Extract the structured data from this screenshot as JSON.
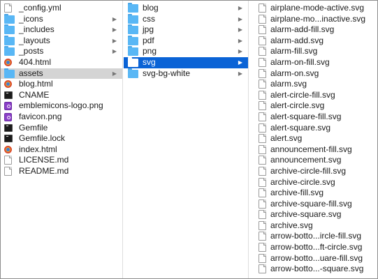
{
  "colors": {
    "folder": "#59b7f5",
    "folder_tab": "#4aa6e6",
    "folder_on_blue": "#ffffff",
    "selection_active": "#0a63d6",
    "selection_inactive": "#d4d4d4"
  },
  "column1": {
    "items": [
      {
        "label": "_config.yml",
        "icon": "document-icon",
        "chevron": false
      },
      {
        "label": "_icons",
        "icon": "folder-icon",
        "chevron": true
      },
      {
        "label": "_includes",
        "icon": "folder-icon",
        "chevron": true
      },
      {
        "label": "_layouts",
        "icon": "folder-icon",
        "chevron": true
      },
      {
        "label": "_posts",
        "icon": "folder-icon",
        "chevron": true
      },
      {
        "label": "404.html",
        "icon": "html-icon",
        "chevron": false
      },
      {
        "label": "assets",
        "icon": "folder-icon",
        "chevron": true,
        "selected": "inactive"
      },
      {
        "label": "blog.html",
        "icon": "html-icon",
        "chevron": false
      },
      {
        "label": "CNAME",
        "icon": "terminal-icon",
        "chevron": false
      },
      {
        "label": "emblemicons-logo.png",
        "icon": "png-icon",
        "chevron": false
      },
      {
        "label": "favicon.png",
        "icon": "png-icon",
        "chevron": false
      },
      {
        "label": "Gemfile",
        "icon": "terminal-icon",
        "chevron": false
      },
      {
        "label": "Gemfile.lock",
        "icon": "terminal-icon",
        "chevron": false
      },
      {
        "label": "index.html",
        "icon": "html-icon",
        "chevron": false
      },
      {
        "label": "LICENSE.md",
        "icon": "document-icon",
        "chevron": false
      },
      {
        "label": "README.md",
        "icon": "document-icon",
        "chevron": false
      }
    ]
  },
  "column2": {
    "items": [
      {
        "label": "blog",
        "icon": "folder-icon",
        "chevron": true
      },
      {
        "label": "css",
        "icon": "folder-icon",
        "chevron": true
      },
      {
        "label": "jpg",
        "icon": "folder-icon",
        "chevron": true
      },
      {
        "label": "pdf",
        "icon": "folder-icon",
        "chevron": true
      },
      {
        "label": "png",
        "icon": "folder-icon",
        "chevron": true
      },
      {
        "label": "svg",
        "icon": "folder-icon",
        "chevron": true,
        "selected": "active"
      },
      {
        "label": "svg-bg-white",
        "icon": "folder-icon",
        "chevron": true
      }
    ]
  },
  "column3": {
    "items": [
      {
        "label": "airplane-mode-active.svg",
        "icon": "document-icon"
      },
      {
        "label": "airplane-mo...inactive.svg",
        "icon": "document-icon"
      },
      {
        "label": "alarm-add-fill.svg",
        "icon": "document-icon"
      },
      {
        "label": "alarm-add.svg",
        "icon": "document-icon"
      },
      {
        "label": "alarm-fill.svg",
        "icon": "document-icon"
      },
      {
        "label": "alarm-on-fill.svg",
        "icon": "document-icon"
      },
      {
        "label": "alarm-on.svg",
        "icon": "document-icon"
      },
      {
        "label": "alarm.svg",
        "icon": "document-icon"
      },
      {
        "label": "alert-circle-fill.svg",
        "icon": "document-icon"
      },
      {
        "label": "alert-circle.svg",
        "icon": "document-icon"
      },
      {
        "label": "alert-square-fill.svg",
        "icon": "document-icon"
      },
      {
        "label": "alert-square.svg",
        "icon": "document-icon"
      },
      {
        "label": "alert.svg",
        "icon": "document-icon"
      },
      {
        "label": "announcement-fill.svg",
        "icon": "document-icon"
      },
      {
        "label": "announcement.svg",
        "icon": "document-icon"
      },
      {
        "label": "archive-circle-fill.svg",
        "icon": "document-icon"
      },
      {
        "label": "archive-circle.svg",
        "icon": "document-icon"
      },
      {
        "label": "archive-fill.svg",
        "icon": "document-icon"
      },
      {
        "label": "archive-square-fill.svg",
        "icon": "document-icon"
      },
      {
        "label": "archive-square.svg",
        "icon": "document-icon"
      },
      {
        "label": "archive.svg",
        "icon": "document-icon"
      },
      {
        "label": "arrow-botto...ircle-fill.svg",
        "icon": "document-icon"
      },
      {
        "label": "arrow-botto...ft-circle.svg",
        "icon": "document-icon"
      },
      {
        "label": "arrow-botto...uare-fill.svg",
        "icon": "document-icon"
      },
      {
        "label": "arrow-botto...-square.svg",
        "icon": "document-icon"
      }
    ]
  }
}
